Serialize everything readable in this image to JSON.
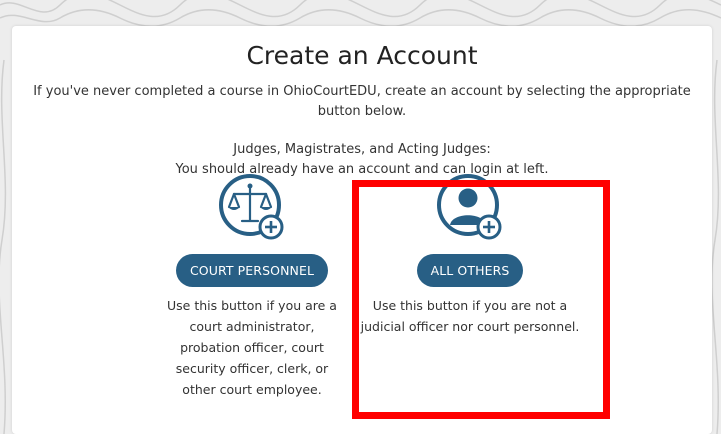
{
  "page": {
    "title": "Create an Account",
    "intro": "If you've never completed a course in OhioCourtEDU, create an account by selecting the appropriate button below.",
    "judges_line1": "Judges, Magistrates, and Acting Judges:",
    "judges_line2": "You should already have an account and can login at left."
  },
  "options": [
    {
      "icon": "scales-of-justice-icon",
      "button_label": "COURT PERSONNEL",
      "description": "Use this button if you are a court administrator, probation officer, court security officer, clerk, or other court employee."
    },
    {
      "icon": "user-add-icon",
      "button_label": "ALL OTHERS",
      "description": "Use this button if you are not a judicial officer nor court personnel."
    }
  ],
  "colors": {
    "brand": "#285f85",
    "highlight": "#ff0000"
  }
}
